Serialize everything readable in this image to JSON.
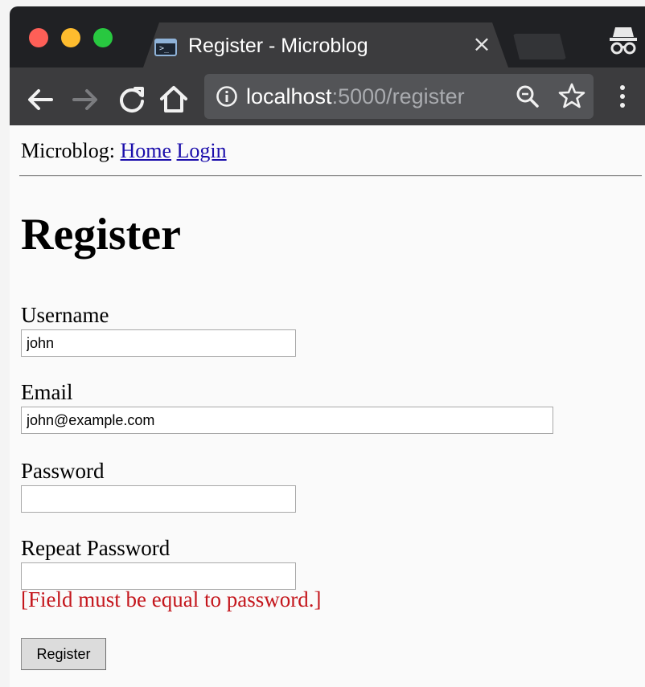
{
  "browser": {
    "tab": {
      "title": "Register - Microblog",
      "close_glyph": "×",
      "favicon": "terminal-icon"
    },
    "address_bar": {
      "host": "localhost",
      "rest": ":5000/register"
    },
    "icons": [
      "back-arrow-icon",
      "forward-arrow-icon",
      "reload-icon",
      "home-icon",
      "info-icon",
      "zoom-icon",
      "star-icon",
      "menu-icon",
      "incognito-icon"
    ]
  },
  "page": {
    "nav": {
      "brand": "Microblog:",
      "links": [
        "Home",
        "Login"
      ]
    },
    "heading": "Register",
    "form": {
      "username": {
        "label": "Username",
        "value": "john"
      },
      "email": {
        "label": "Email",
        "value": "john@example.com"
      },
      "password": {
        "label": "Password",
        "value": ""
      },
      "repeat_password": {
        "label": "Repeat Password",
        "value": "",
        "error": "[Field must be equal to password.]"
      },
      "submit_label": "Register"
    }
  },
  "colors": {
    "tabstrip": "#202124",
    "toolbar": "#3c3c3e",
    "omnibox": "#535457",
    "link": "#1a0dab",
    "error": "#c4161c"
  }
}
